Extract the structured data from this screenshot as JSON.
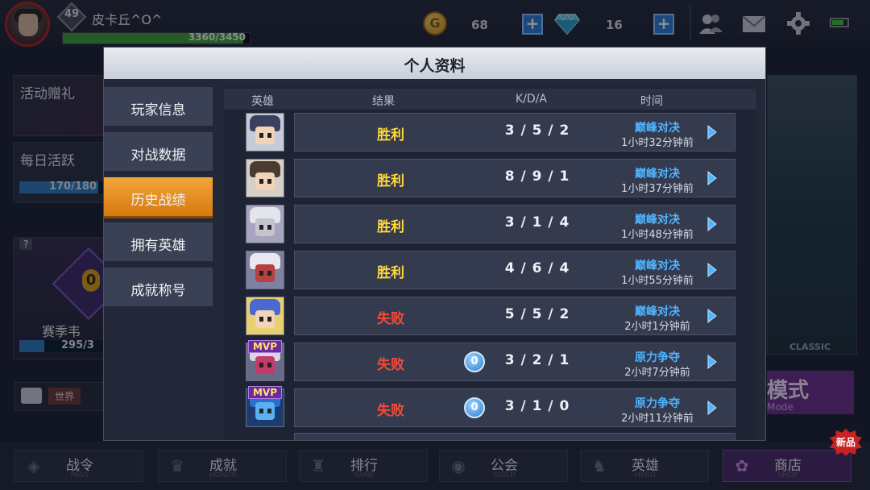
{
  "player": {
    "level": "49",
    "name": "皮卡丘^O^",
    "xp_text": "3360/3450",
    "xp_progress": 0.974
  },
  "currency": {
    "gold": "68",
    "gold_symbol": "G",
    "gems": "16",
    "plus": "+"
  },
  "side_left": {
    "gift_label": "活动赠礼",
    "daily_label": "每日活跃",
    "daily_text": "170/180",
    "daily_progress": 0.944,
    "season_badge": "?",
    "season_level": "0",
    "season_label": "赛季韦",
    "season_text": "295/3",
    "season_progress": 0.3,
    "chat_channel": "世界"
  },
  "side_right": {
    "classic_label": "CLASSIC",
    "mode_label": "模式",
    "mode_sub": "Mode"
  },
  "modal": {
    "title": "个人资料",
    "tabs": [
      {
        "label": "玩家信息"
      },
      {
        "label": "对战数据"
      },
      {
        "label": "历史战绩"
      },
      {
        "label": "拥有英雄"
      },
      {
        "label": "成就称号"
      }
    ],
    "active_tab": 2,
    "columns": {
      "hero": "英雄",
      "result": "结果",
      "kda": "K/D/A",
      "time": "时间"
    },
    "matches": [
      {
        "result": "胜利",
        "win": true,
        "kda": "3 / 5 / 2",
        "mode": "巅峰对决",
        "ago": "1小时32分钟前",
        "mvp": false,
        "coin": false
      },
      {
        "result": "胜利",
        "win": true,
        "kda": "8 / 9 / 1",
        "mode": "巅峰对决",
        "ago": "1小时37分钟前",
        "mvp": false,
        "coin": false
      },
      {
        "result": "胜利",
        "win": true,
        "kda": "3 / 1 / 4",
        "mode": "巅峰对决",
        "ago": "1小时48分钟前",
        "mvp": false,
        "coin": false
      },
      {
        "result": "胜利",
        "win": true,
        "kda": "4 / 6 / 4",
        "mode": "巅峰对决",
        "ago": "1小时55分钟前",
        "mvp": false,
        "coin": false
      },
      {
        "result": "失败",
        "win": false,
        "kda": "5 / 5 / 2",
        "mode": "巅峰对决",
        "ago": "2小时1分钟前",
        "mvp": false,
        "coin": false
      },
      {
        "result": "失败",
        "win": false,
        "kda": "3 / 2 / 1",
        "mode": "原力争夺",
        "ago": "2小时7分钟前",
        "mvp": true,
        "coin": true,
        "coin_value": "0"
      },
      {
        "result": "失败",
        "win": false,
        "kda": "3 / 1 / 0",
        "mode": "原力争夺",
        "ago": "2小时11分钟前",
        "mvp": true,
        "coin": true,
        "coin_value": "0"
      }
    ],
    "mvp_label": "MVP"
  },
  "bottom_nav": [
    {
      "cn": "战令",
      "en": "PASS"
    },
    {
      "cn": "成就",
      "en": "HONOR"
    },
    {
      "cn": "排行",
      "en": "RANK"
    },
    {
      "cn": "公会",
      "en": "GUILD"
    },
    {
      "cn": "英雄",
      "en": "HERO"
    },
    {
      "cn": "商店",
      "en": "SHOP"
    }
  ],
  "new_badge": "新品",
  "colors": {
    "win": "#ffd83a",
    "lose": "#f24a3a",
    "mode": "#4fb4ff",
    "tab_active": "#e8901f"
  }
}
